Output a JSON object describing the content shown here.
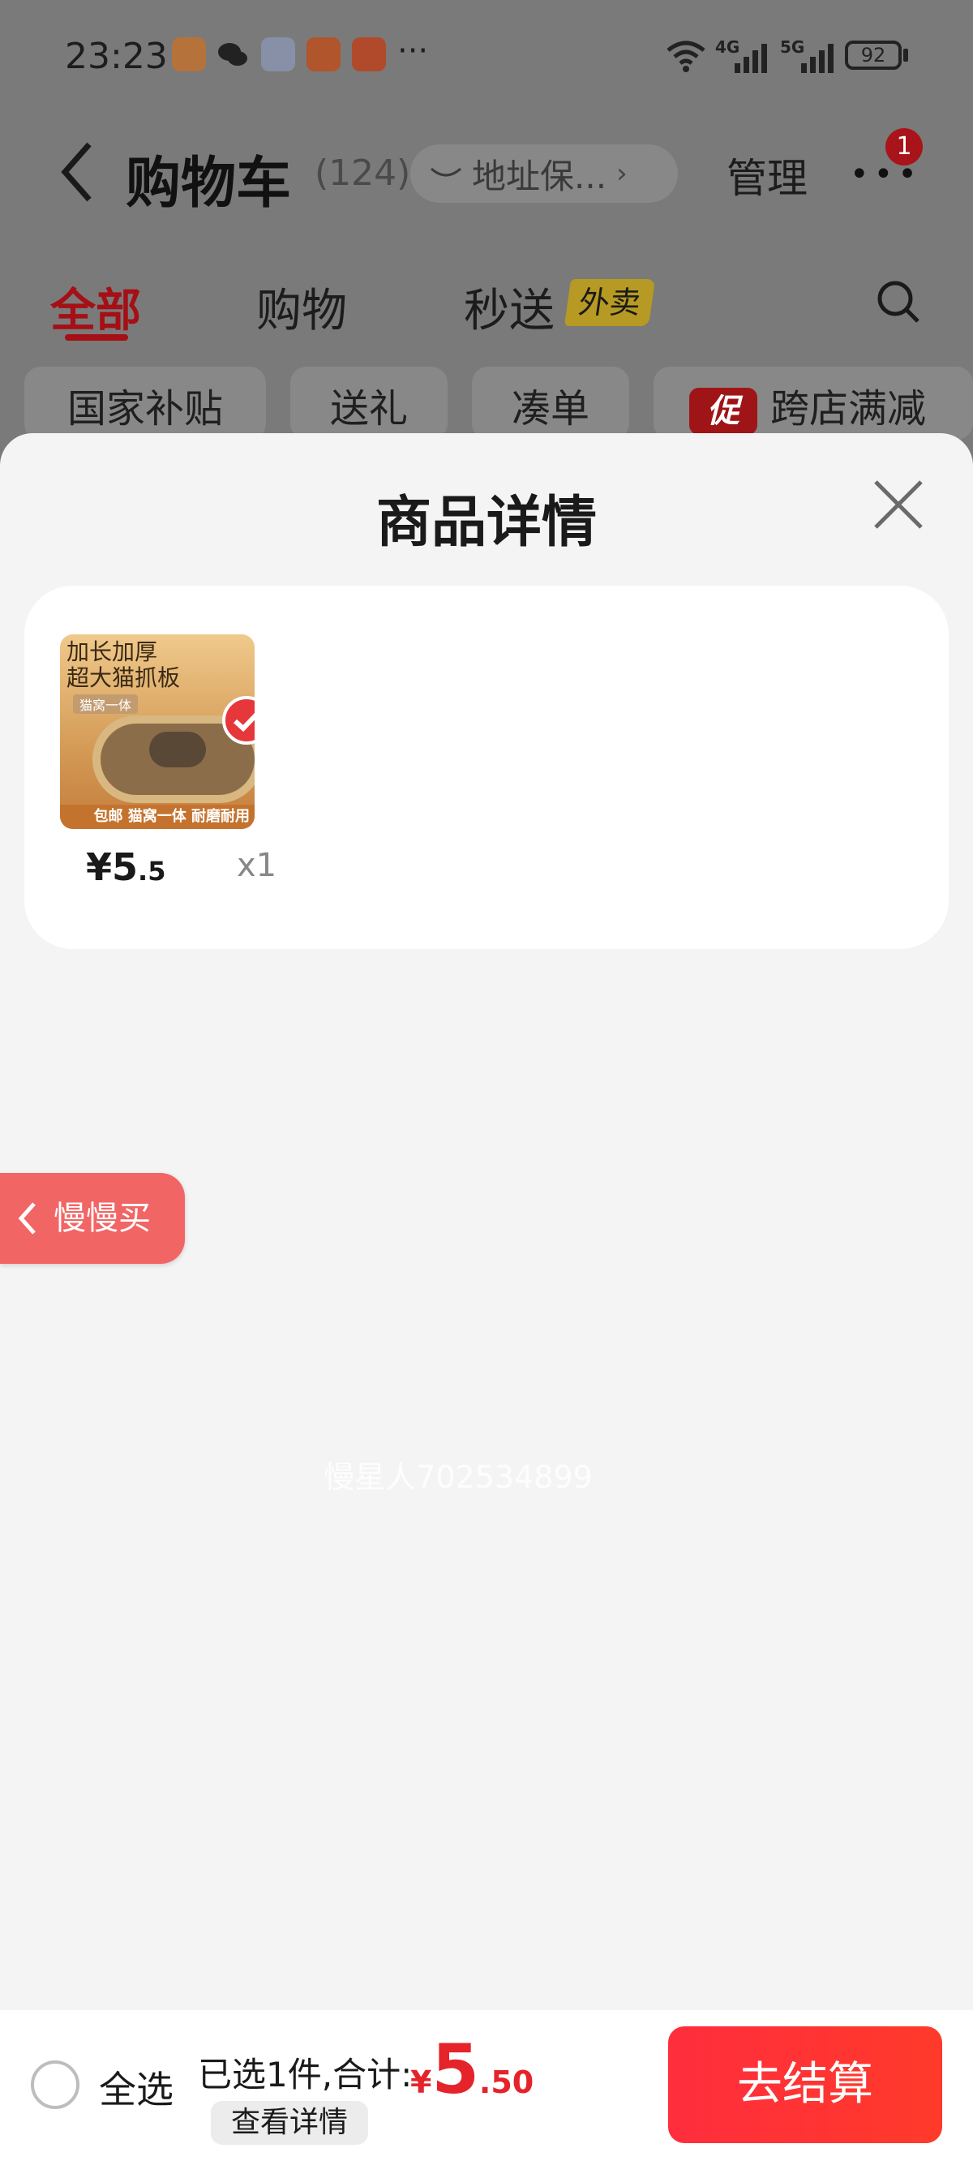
{
  "status_bar": {
    "time": "23:23",
    "more_glyph": "···",
    "network1": "4G",
    "network2": "5G",
    "battery": "92"
  },
  "header": {
    "title": "购物车",
    "count": "(124)",
    "address": "地址保...",
    "address_chevron": "›",
    "manage": "管理",
    "more": "•••",
    "badge": "1"
  },
  "tabs": {
    "all": "全部",
    "shopping": "购物",
    "express": "秒送",
    "express_tag": "外卖"
  },
  "chips": {
    "subsidy": "国家补贴",
    "gift": "送礼",
    "combine": "凑单",
    "promo_tag": "促",
    "cross_store": "跨店满减"
  },
  "sheet": {
    "title": "商品详情"
  },
  "product": {
    "image_text_line1": "加长加厚",
    "image_text_line2": "超大猫抓板",
    "image_small": "猫窝一体",
    "image_bottom": "包邮  猫窝一体 耐磨耐用",
    "price_symbol": "¥",
    "price_int": "5",
    "price_dec": ".5",
    "qty": "x1"
  },
  "side_button": {
    "label": "慢慢买"
  },
  "watermark": "慢星人702534899",
  "footer": {
    "select_all": "全选",
    "summary": "已选1件,合计:",
    "currency": "¥",
    "total_int": "5",
    "total_dec": ".50",
    "view_details": "查看详情",
    "checkout": "去结算"
  },
  "colors": {
    "accent": "#e5232a",
    "dark_red_dimmed": "#a50f15",
    "overlay": "#7a7a7a"
  }
}
